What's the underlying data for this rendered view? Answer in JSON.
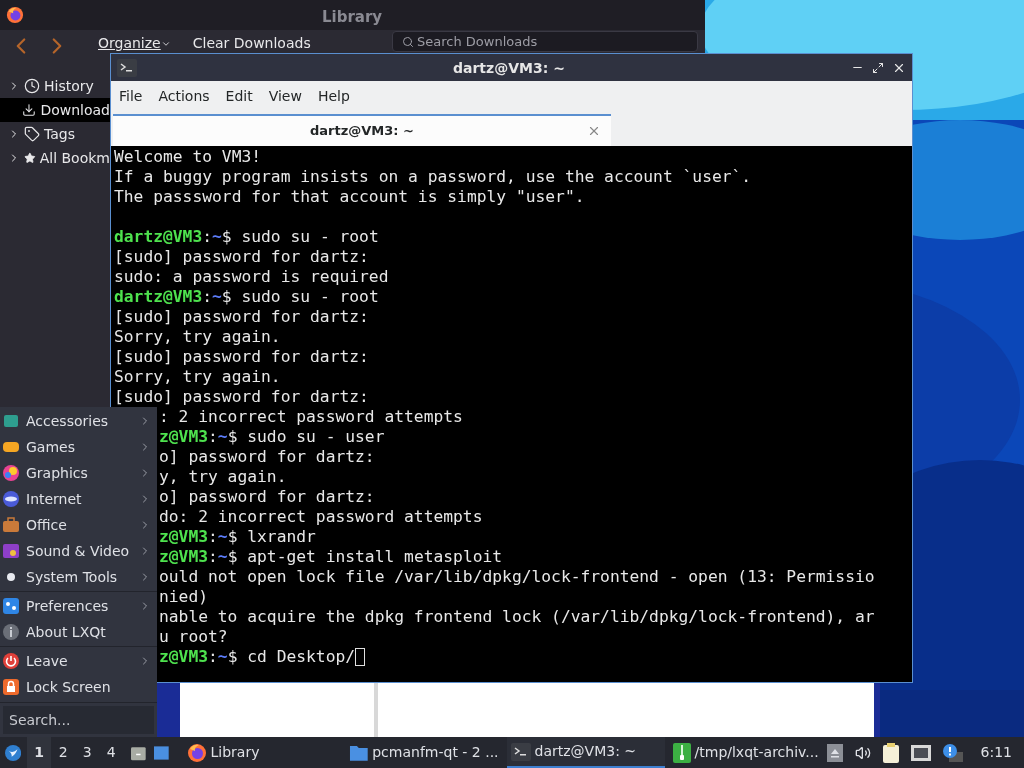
{
  "library_window": {
    "title": "Library",
    "toolbar": {
      "organize": "Organize",
      "clear": "Clear Downloads",
      "search_placeholder": "Search Downloads"
    },
    "sidebar": [
      {
        "label": "History",
        "kind": "clock",
        "expandable": true,
        "selected": false
      },
      {
        "label": "Download",
        "kind": "download",
        "expandable": false,
        "selected": true
      },
      {
        "label": "Tags",
        "kind": "tag",
        "expandable": true,
        "selected": false
      },
      {
        "label": "All Bookm",
        "kind": "star",
        "expandable": true,
        "selected": false
      }
    ]
  },
  "terminal_window": {
    "title": "dartz@VM3: ~",
    "menu": [
      "File",
      "Actions",
      "Edit",
      "View",
      "Help"
    ],
    "tabs": [
      {
        "label": "dartz@VM3: ~",
        "selected": true
      }
    ],
    "lines": [
      {
        "kind": "output",
        "text": "Welcome to VM3!"
      },
      {
        "kind": "output",
        "text": "If a buggy program insists on a password, use the account `user`."
      },
      {
        "kind": "output",
        "text": "The passsword for that account is simply \"user\"."
      },
      {
        "kind": "blank"
      },
      {
        "kind": "prompt",
        "user": "dartz@VM3",
        "sep": ":",
        "path": "~",
        "rest": "$ sudo su - root"
      },
      {
        "kind": "output",
        "text": "[sudo] password for dartz:"
      },
      {
        "kind": "output",
        "text": "sudo: a password is required"
      },
      {
        "kind": "prompt",
        "user": "dartz@VM3",
        "sep": ":",
        "path": "~",
        "rest": "$ sudo su - root"
      },
      {
        "kind": "output",
        "text": "[sudo] password for dartz:"
      },
      {
        "kind": "output",
        "text": "Sorry, try again."
      },
      {
        "kind": "output",
        "text": "[sudo] password for dartz:"
      },
      {
        "kind": "output",
        "text": "Sorry, try again."
      },
      {
        "kind": "output",
        "text": "[sudo] password for dartz:"
      }
    ],
    "lines_beside_menu": [
      {
        "kind": "output",
        "text": ": 2 incorrect password attempts"
      },
      {
        "kind": "prompt",
        "user": "z@VM3",
        "sep": ":",
        "path": "~",
        "rest": "$ sudo su - user"
      },
      {
        "kind": "output",
        "text": "o] password for dartz:"
      },
      {
        "kind": "output",
        "text": "y, try again."
      },
      {
        "kind": "output",
        "text": "o] password for dartz:"
      },
      {
        "kind": "output",
        "text": "do: 2 incorrect password attempts"
      },
      {
        "kind": "prompt",
        "user": "z@VM3",
        "sep": ":",
        "path": "~",
        "rest": "$ lxrandr"
      },
      {
        "kind": "prompt",
        "user": "z@VM3",
        "sep": ":",
        "path": "~",
        "rest": "$ apt-get install metasploit"
      },
      {
        "kind": "output",
        "text": "ould not open lock file /var/lib/dpkg/lock-frontend - open (13: Permissio"
      },
      {
        "kind": "output",
        "text": "nied)"
      },
      {
        "kind": "output",
        "text": "nable to acquire the dpkg frontend lock (/var/lib/dpkg/lock-frontend), ar"
      },
      {
        "kind": "output",
        "text": "u root?"
      },
      {
        "kind": "prompt",
        "user": "z@VM3",
        "sep": ":",
        "path": "~",
        "rest": "$ cd Desktop/",
        "cursor": true
      }
    ]
  },
  "start_menu": {
    "groups": [
      [
        {
          "label": "Accessories",
          "kind": "accessories",
          "submenu": true
        },
        {
          "label": "Games",
          "kind": "games",
          "submenu": true
        },
        {
          "label": "Graphics",
          "kind": "graphics",
          "submenu": true
        },
        {
          "label": "Internet",
          "kind": "internet",
          "submenu": true
        },
        {
          "label": "Office",
          "kind": "office",
          "submenu": true
        },
        {
          "label": "Sound & Video",
          "kind": "media",
          "submenu": true
        },
        {
          "label": "System Tools",
          "kind": "system",
          "submenu": true
        }
      ],
      [
        {
          "label": "Preferences",
          "kind": "preferences",
          "submenu": true
        },
        {
          "label": "About LXQt",
          "kind": "about",
          "submenu": false
        }
      ],
      [
        {
          "label": "Leave",
          "kind": "leave",
          "submenu": true
        },
        {
          "label": "Lock Screen",
          "kind": "lock",
          "submenu": false
        }
      ]
    ],
    "search_placeholder": "Search..."
  },
  "taskbar": {
    "desktops": [
      {
        "label": "1",
        "selected": true
      },
      {
        "label": "2",
        "selected": false
      },
      {
        "label": "3",
        "selected": false
      },
      {
        "label": "4",
        "selected": false
      }
    ],
    "tasks": [
      {
        "label": "Library",
        "kind": "browser",
        "selected": false
      },
      {
        "label": "pcmanfm-qt - 2 ...",
        "kind": "folder",
        "selected": false
      },
      {
        "label": "dartz@VM3: ~",
        "kind": "terminal",
        "selected": true
      },
      {
        "label": "/tmp/lxqt-archiv...",
        "kind": "archive",
        "selected": false
      }
    ],
    "clock": "6:11"
  }
}
